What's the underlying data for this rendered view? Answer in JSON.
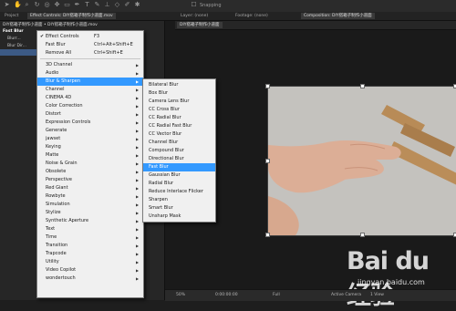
{
  "toolbar": {
    "snapping_label": "Snapping"
  },
  "tabs": {
    "project": "Project",
    "effect_controls": "Effect Controls: DIY搭箱子制作小道面.mov",
    "layer": "Layer: (none)",
    "footage": "Footage: (none)",
    "composition": "Composition: DIY搭箱子制作小道面"
  },
  "left_panel": {
    "header": "DIY搭箱子制作小道面 • DIY搭箱子制作小道面.mov",
    "layers": [
      {
        "label": "Fast Blur",
        "selected": true
      },
      {
        "label": "Blurr..."
      },
      {
        "label": "Blur Dir..."
      }
    ]
  },
  "comp_view": {
    "title_tab": "DIY搭箱子制作小道面"
  },
  "statusbar": {
    "zoom": "50%",
    "timecode": "0:00:00:00",
    "resolution": "Full",
    "camera": "Active Camera",
    "views": "1 View"
  },
  "context_menu": {
    "items": [
      {
        "label": "Effect Controls",
        "shortcut": "F3",
        "checked": true
      },
      {
        "label": "Fast Blur",
        "shortcut": "Ctrl+Alt+Shift+E"
      },
      {
        "label": "Remove All",
        "shortcut": "Ctrl+Shift+E"
      },
      {
        "separator": true
      },
      {
        "label": "3D Channel",
        "submenu": true
      },
      {
        "label": "Audio",
        "submenu": true
      },
      {
        "label": "Blur & Sharpen",
        "submenu": true,
        "highlighted": true
      },
      {
        "label": "Channel",
        "submenu": true
      },
      {
        "label": "CINEMA 4D",
        "submenu": true
      },
      {
        "label": "Color Correction",
        "submenu": true
      },
      {
        "label": "Distort",
        "submenu": true
      },
      {
        "label": "Expression Controls",
        "submenu": true
      },
      {
        "label": "Generate",
        "submenu": true
      },
      {
        "label": "jawset",
        "submenu": true
      },
      {
        "label": "Keying",
        "submenu": true
      },
      {
        "label": "Matte",
        "submenu": true
      },
      {
        "label": "Noise & Grain",
        "submenu": true
      },
      {
        "label": "Obsolete",
        "submenu": true
      },
      {
        "label": "Perspective",
        "submenu": true
      },
      {
        "label": "Red Giant",
        "submenu": true
      },
      {
        "label": "Rowbyte",
        "submenu": true
      },
      {
        "label": "Simulation",
        "submenu": true
      },
      {
        "label": "Stylize",
        "submenu": true
      },
      {
        "label": "Synthetic Aperture",
        "submenu": true
      },
      {
        "label": "Text",
        "submenu": true
      },
      {
        "label": "Time",
        "submenu": true
      },
      {
        "label": "Transition",
        "submenu": true
      },
      {
        "label": "Trapcode",
        "submenu": true
      },
      {
        "label": "Utility",
        "submenu": true
      },
      {
        "label": "Video Copilot",
        "submenu": true
      },
      {
        "label": "wondertouch",
        "submenu": true
      }
    ]
  },
  "submenu": {
    "items": [
      {
        "label": "Bilateral Blur"
      },
      {
        "label": "Box Blur"
      },
      {
        "label": "Camera Lens Blur"
      },
      {
        "label": "CC Cross Blur"
      },
      {
        "label": "CC Radial Blur"
      },
      {
        "label": "CC Radial Fast Blur"
      },
      {
        "label": "CC Vector Blur"
      },
      {
        "label": "Channel Blur"
      },
      {
        "label": "Compound Blur"
      },
      {
        "label": "Directional Blur"
      },
      {
        "label": "Fast Blur",
        "highlighted": true
      },
      {
        "label": "Gaussian Blur"
      },
      {
        "label": "Radial Blur"
      },
      {
        "label": "Reduce Interlace Flicker"
      },
      {
        "label": "Sharpen"
      },
      {
        "label": "Smart Blur"
      },
      {
        "label": "Unsharp Mask"
      }
    ]
  },
  "watermark": {
    "brand": "Bai du 经验",
    "url": "jingyan.baidu.com"
  },
  "colors": {
    "highlight": "#3399ff",
    "menu_bg": "#f0f0f0",
    "app_bg": "#1e1e1e"
  }
}
